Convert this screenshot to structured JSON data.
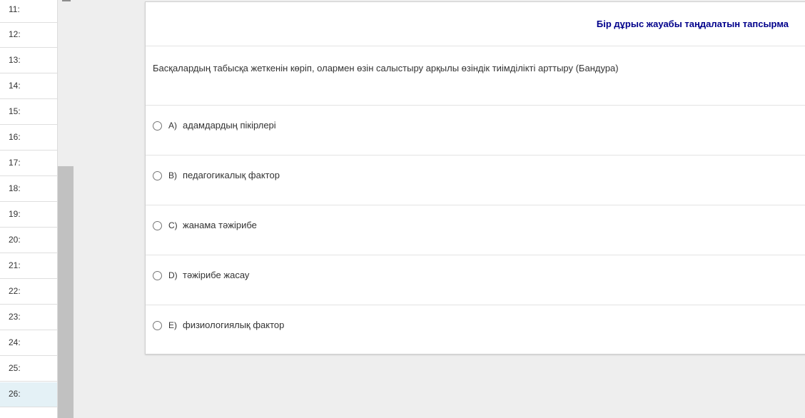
{
  "question_list": {
    "items": [
      "11:",
      "12:",
      "13:",
      "14:",
      "15:",
      "16:",
      "17:",
      "18:",
      "19:",
      "20:",
      "21:",
      "22:",
      "23:",
      "24:",
      "25:",
      "26:"
    ],
    "active_item": "26:"
  },
  "question": {
    "type_label": "Бір дұрыс жауабы таңдалатын тапсырма",
    "text": "Басқалардың табысқа жеткенін көріп, олармен өзін салыстыру арқылы өзіндік тиімділікті арттыру (Бандура)",
    "options": [
      {
        "letter": "A)",
        "text": "адамдардың пікірлері"
      },
      {
        "letter": "B)",
        "text": "педагогикалық фактор"
      },
      {
        "letter": "C)",
        "text": "жанама тәжірибе"
      },
      {
        "letter": "D)",
        "text": "тәжірибе жасау"
      },
      {
        "letter": "E)",
        "text": "физиологиялық фактор"
      }
    ]
  },
  "colors": {
    "type_label": "#00008b",
    "active_item_bg": "#e4f1f6",
    "page_bg": "#eeeeee"
  }
}
